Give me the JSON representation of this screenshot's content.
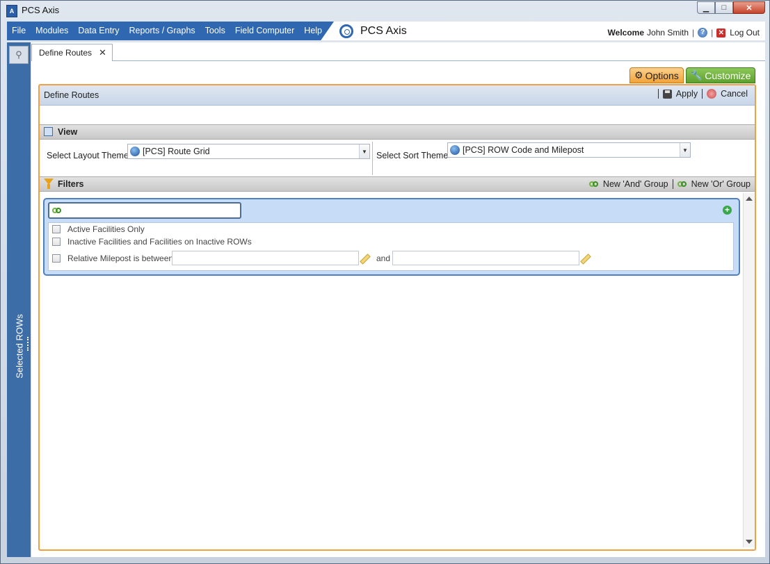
{
  "window": {
    "title": "PCS Axis",
    "controls": {
      "minimize": "▁",
      "maximize": "□",
      "close": "✕"
    }
  },
  "menu": {
    "items": [
      "File",
      "Modules",
      "Data Entry",
      "Reports / Graphs",
      "Tools",
      "Field Computer",
      "Help"
    ],
    "brand": "PCS Axis",
    "welcome": "Welcome",
    "user": "John Smith",
    "help_icon": "?",
    "logout_icon": "✕",
    "logout": "Log Out"
  },
  "sidebar": {
    "search_icon": "⚲",
    "label": "Selected ROWs"
  },
  "tabs": [
    {
      "label": "Define Routes",
      "close": "✕"
    }
  ],
  "options_bar": {
    "options": "Options",
    "options_icon": "⚙",
    "customize": "Customize",
    "customize_icon": "🔧"
  },
  "panel": {
    "title": "Define Routes",
    "apply": "Apply",
    "cancel": "Cancel",
    "view": {
      "title": "View",
      "layout_label": "Select Layout Theme",
      "layout_value": "[PCS] Route Grid",
      "sort_label": "Select Sort Theme",
      "sort_value": "[PCS] ROW Code and Milepost",
      "dropdown_arrow": "▼"
    },
    "filters": {
      "title": "Filters",
      "new_and_group": "New 'And' Group",
      "new_or_group": "New 'Or' Group",
      "add_icon": "+",
      "group": {
        "name_value": "",
        "rows": [
          {
            "label": "Active Facilities Only",
            "checked": false
          },
          {
            "label": "Inactive Facilities and Facilities on Inactive ROWs",
            "checked": false
          }
        ],
        "milepost": {
          "label": "Relative Milepost is between",
          "and": "and",
          "from": "",
          "to": ""
        }
      }
    }
  },
  "colors": {
    "accent": "#2f67b0",
    "options": "#f2a33a",
    "customize": "#5ea02e",
    "panel_border": "#f0a044"
  }
}
